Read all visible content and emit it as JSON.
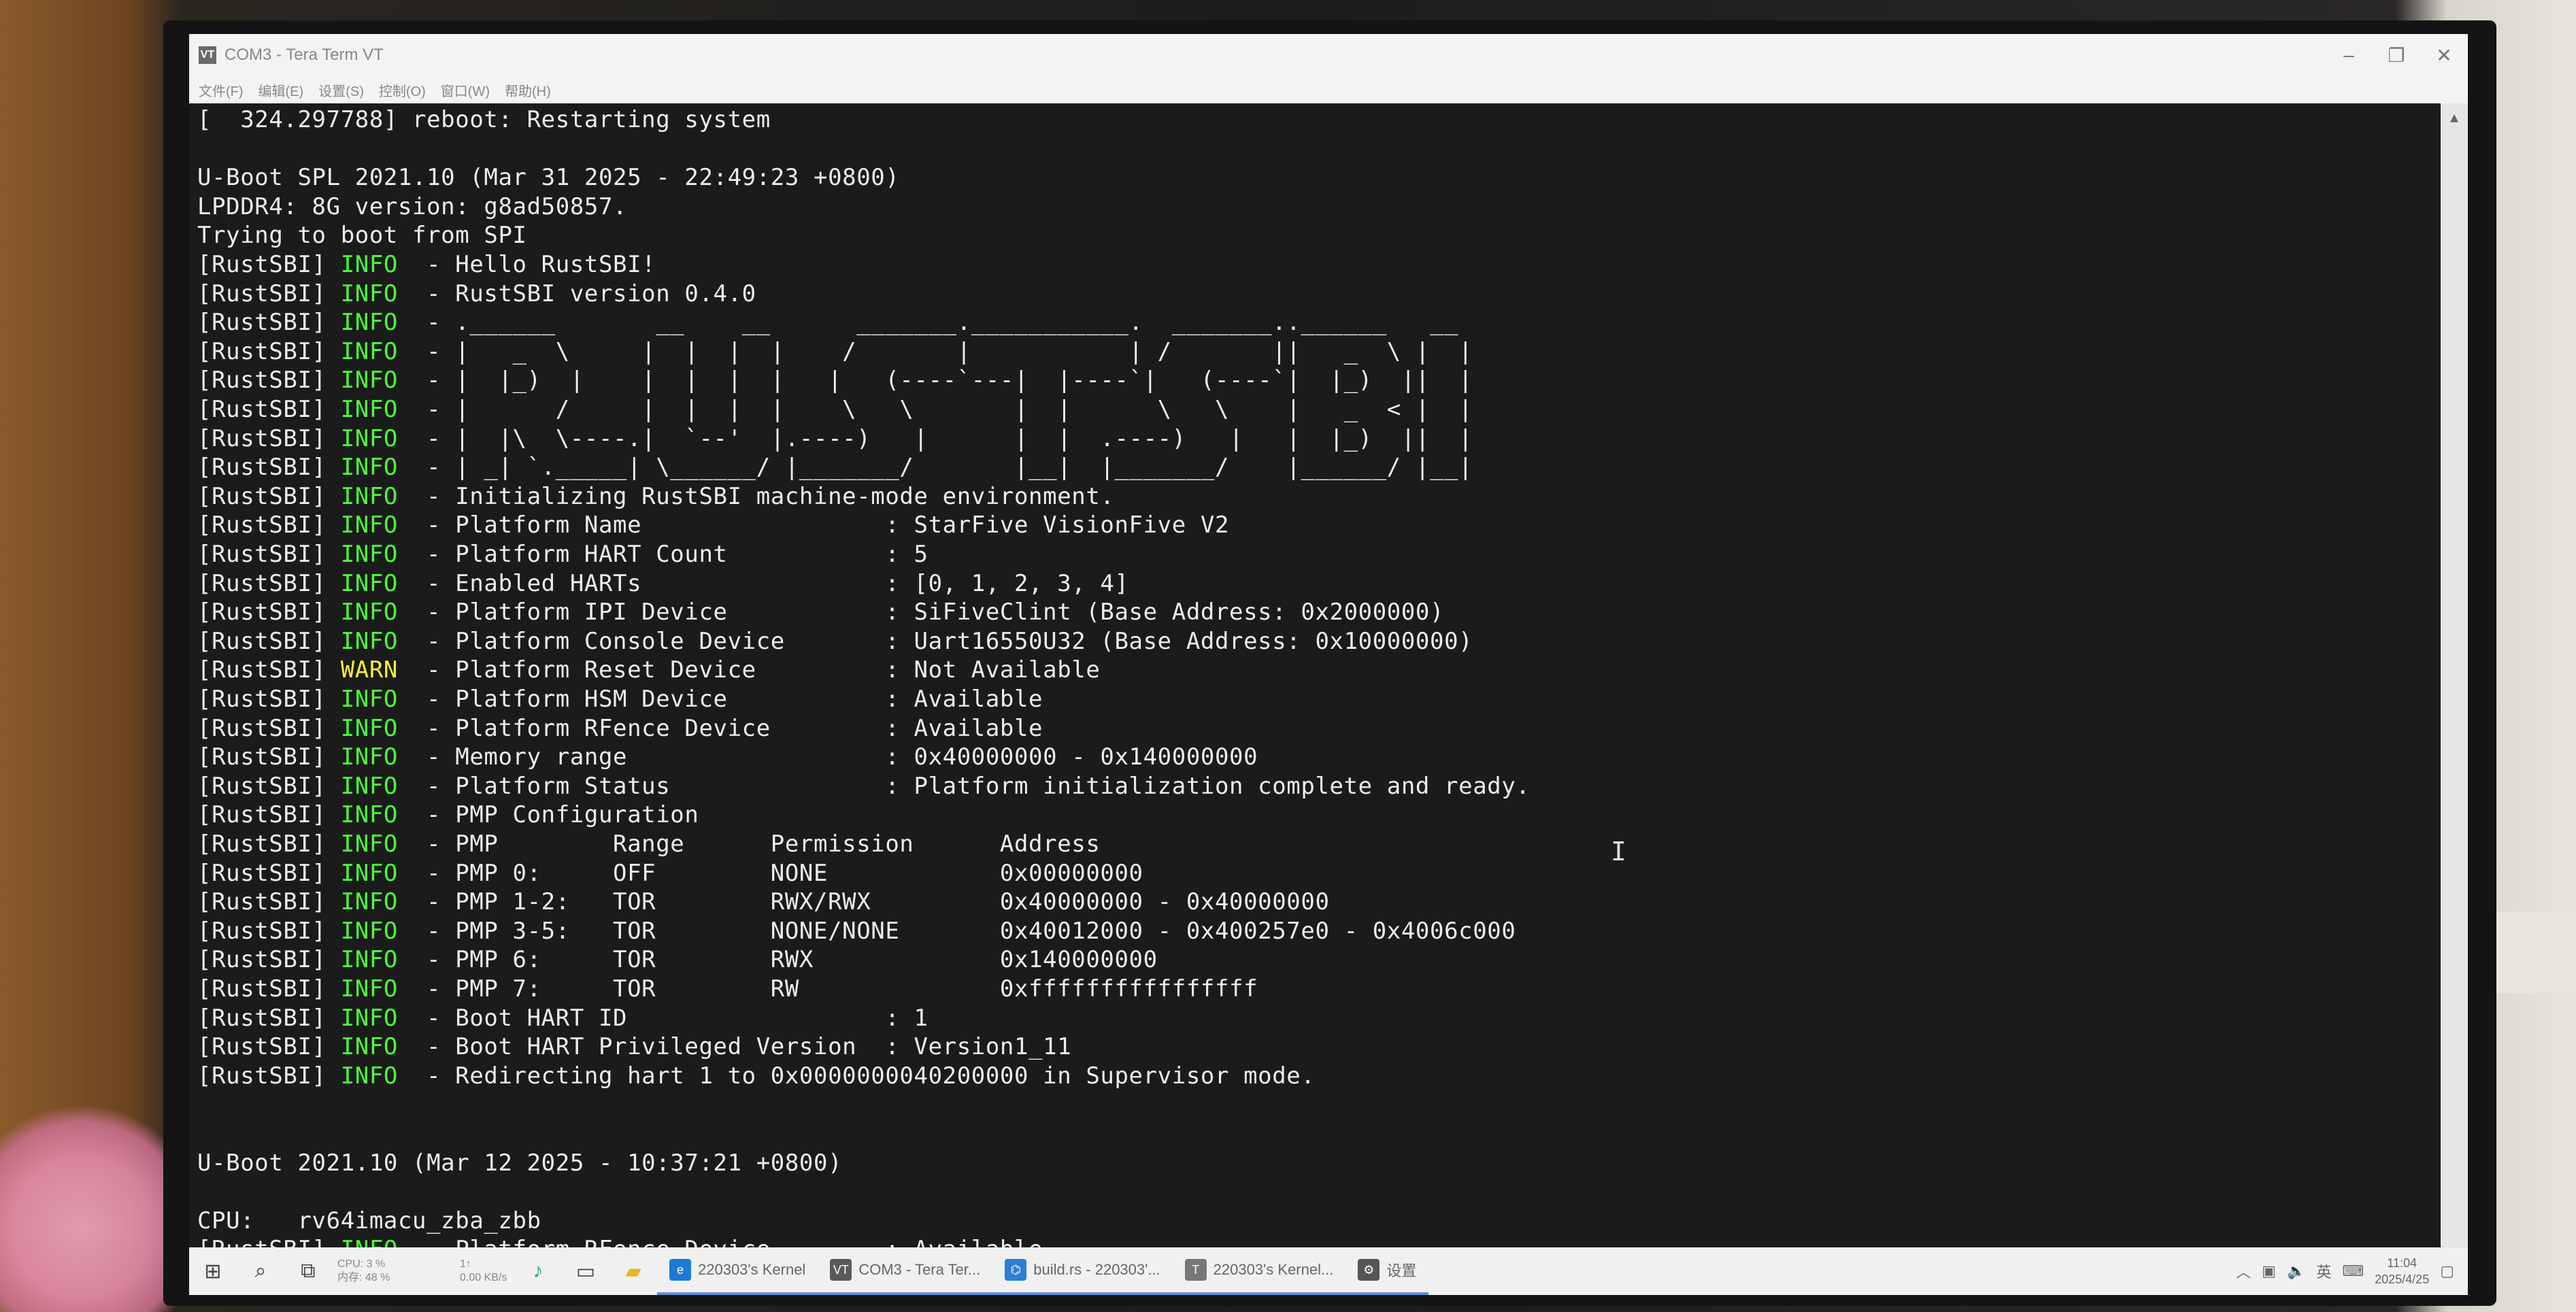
{
  "window": {
    "title": "COM3 - Tera Term VT",
    "app_icon": "VT",
    "controls": [
      "–",
      "❐",
      "✕"
    ]
  },
  "menu": [
    "文件(F)",
    "编辑(E)",
    "设置(S)",
    "控制(O)",
    "窗口(W)",
    "帮助(H)"
  ],
  "terminal": {
    "lines": [
      {
        "text": "[  324.297788] reboot: Restarting system"
      },
      {
        "text": ""
      },
      {
        "text": "U-Boot SPL 2021.10 (Mar 31 2025 - 22:49:23 +0800)"
      },
      {
        "text": "LPDDR4: 8G version: g8ad50857."
      },
      {
        "text": "Trying to boot from SPI"
      },
      {
        "prefix": "[RustSBI] ",
        "level": "INFO",
        "text": "  - Hello RustSBI!"
      },
      {
        "prefix": "[RustSBI] ",
        "level": "INFO",
        "text": "  - RustSBI version 0.4.0"
      },
      {
        "prefix": "[RustSBI] ",
        "level": "INFO",
        "text": "  - .______       __    __      _______.___________.  _______..______   __"
      },
      {
        "prefix": "[RustSBI] ",
        "level": "INFO",
        "text": "  - |   _  \\     |  |  |  |    /       |           | /       ||   _  \\ |  |"
      },
      {
        "prefix": "[RustSBI] ",
        "level": "INFO",
        "text": "  - |  |_)  |    |  |  |  |   |   (----`---|  |----`|   (----`|  |_)  ||  |"
      },
      {
        "prefix": "[RustSBI] ",
        "level": "INFO",
        "text": "  - |      /     |  |  |  |    \\   \\       |  |      \\   \\    |   _  < |  |"
      },
      {
        "prefix": "[RustSBI] ",
        "level": "INFO",
        "text": "  - |  |\\  \\----.|  `--'  |.----)   |      |  |  .----)   |   |  |_)  ||  |"
      },
      {
        "prefix": "[RustSBI] ",
        "level": "INFO",
        "text": "  - | _| `._____| \\______/ |_______/       |__|  |_______/    |______/ |__|"
      },
      {
        "prefix": "[RustSBI] ",
        "level": "INFO",
        "text": "  - Initializing RustSBI machine-mode environment."
      },
      {
        "prefix": "[RustSBI] ",
        "level": "INFO",
        "text": "  - Platform Name                 : StarFive VisionFive V2"
      },
      {
        "prefix": "[RustSBI] ",
        "level": "INFO",
        "text": "  - Platform HART Count           : 5"
      },
      {
        "prefix": "[RustSBI] ",
        "level": "INFO",
        "text": "  - Enabled HARTs                 : [0, 1, 2, 3, 4]"
      },
      {
        "prefix": "[RustSBI] ",
        "level": "INFO",
        "text": "  - Platform IPI Device           : SiFiveClint (Base Address: 0x2000000)"
      },
      {
        "prefix": "[RustSBI] ",
        "level": "INFO",
        "text": "  - Platform Console Device       : Uart16550U32 (Base Address: 0x10000000)"
      },
      {
        "prefix": "[RustSBI] ",
        "level": "WARN",
        "text": "  - Platform Reset Device         : Not Available"
      },
      {
        "prefix": "[RustSBI] ",
        "level": "INFO",
        "text": "  - Platform HSM Device           : Available"
      },
      {
        "prefix": "[RustSBI] ",
        "level": "INFO",
        "text": "  - Platform RFence Device        : Available"
      },
      {
        "prefix": "[RustSBI] ",
        "level": "INFO",
        "text": "  - Memory range                  : 0x40000000 - 0x140000000"
      },
      {
        "prefix": "[RustSBI] ",
        "level": "INFO",
        "text": "  - Platform Status               : Platform initialization complete and ready."
      },
      {
        "prefix": "[RustSBI] ",
        "level": "INFO",
        "text": "  - PMP Configuration"
      },
      {
        "prefix": "[RustSBI] ",
        "level": "INFO",
        "text": "  - PMP        Range      Permission      Address"
      },
      {
        "prefix": "[RustSBI] ",
        "level": "INFO",
        "text": "  - PMP 0:     OFF        NONE            0x00000000"
      },
      {
        "prefix": "[RustSBI] ",
        "level": "INFO",
        "text": "  - PMP 1-2:   TOR        RWX/RWX         0x40000000 - 0x40000000"
      },
      {
        "prefix": "[RustSBI] ",
        "level": "INFO",
        "text": "  - PMP 3-5:   TOR        NONE/NONE       0x40012000 - 0x400257e0 - 0x4006c000"
      },
      {
        "prefix": "[RustSBI] ",
        "level": "INFO",
        "text": "  - PMP 6:     TOR        RWX             0x140000000"
      },
      {
        "prefix": "[RustSBI] ",
        "level": "INFO",
        "text": "  - PMP 7:     TOR        RW              0xffffffffffffffff"
      },
      {
        "prefix": "[RustSBI] ",
        "level": "INFO",
        "text": "  - Boot HART ID                  : 1"
      },
      {
        "prefix": "[RustSBI] ",
        "level": "INFO",
        "text": "  - Boot HART Privileged Version  : Version1_11"
      },
      {
        "prefix": "[RustSBI] ",
        "level": "INFO",
        "text": "  - Redirecting hart 1 to 0x0000000040200000 in Supervisor mode."
      },
      {
        "text": ""
      },
      {
        "text": ""
      },
      {
        "text": "U-Boot 2021.10 (Mar 12 2025 - 10:37:21 +0800)"
      },
      {
        "text": ""
      },
      {
        "text": "CPU:   rv64imacu_zba_zbb"
      },
      {
        "prefix": "[RustSBI] ",
        "level": "INFO",
        "text": "  - Platform RFence Device        : Available"
      }
    ]
  },
  "taskbar": {
    "start_icon": "⊞",
    "search_icon": "⌕",
    "taskview_icon": "⧉",
    "perf": {
      "cpu": "CPU: 3 %",
      "mem": "内存: 48 %",
      "net_up": "1↑",
      "net_down": "0.00 KB/s"
    },
    "tasks": [
      {
        "label": "220303's Kernel",
        "icon": "e",
        "color": "#1f7ad6"
      },
      {
        "label": "COM3 - Tera Ter...",
        "icon": "VT",
        "color": "#5a5a5a"
      },
      {
        "label": "build.rs - 220303'...",
        "icon": "⌬",
        "color": "#2b7fd4"
      },
      {
        "label": "220303's Kernel...",
        "icon": "T",
        "color": "#777777"
      },
      {
        "label": "设置",
        "icon": "⚙",
        "color": "#555555"
      }
    ],
    "tray": {
      "ime": "英",
      "time": "11:04",
      "date": "2025/4/25"
    }
  }
}
